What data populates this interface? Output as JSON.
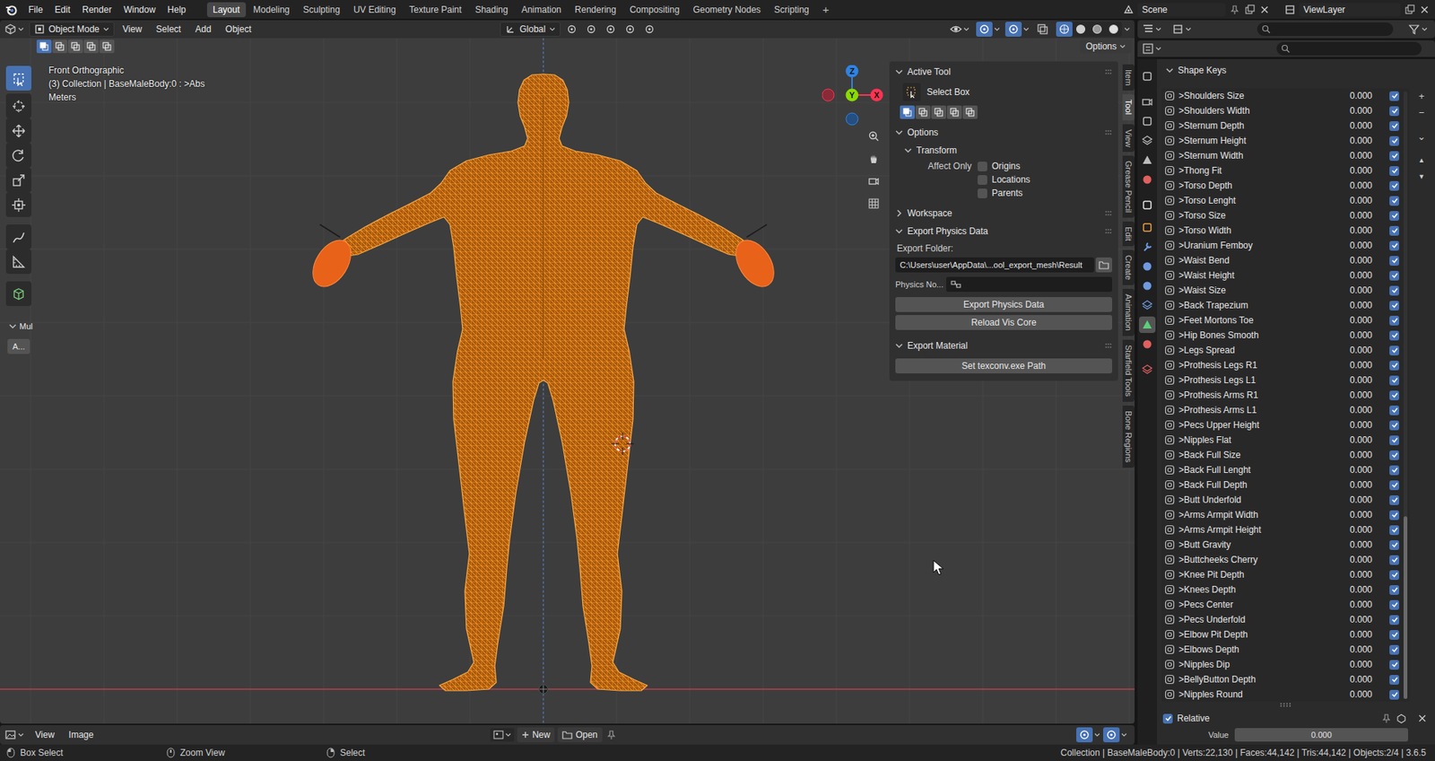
{
  "topbar": {
    "menus": [
      "File",
      "Edit",
      "Render",
      "Window",
      "Help"
    ],
    "workspaces": [
      {
        "label": "Layout",
        "selected": true
      },
      {
        "label": "Modeling",
        "selected": false
      },
      {
        "label": "Sculpting",
        "selected": false
      },
      {
        "label": "UV Editing",
        "selected": false
      },
      {
        "label": "Texture Paint",
        "selected": false
      },
      {
        "label": "Shading",
        "selected": false
      },
      {
        "label": "Animation",
        "selected": false
      },
      {
        "label": "Rendering",
        "selected": false
      },
      {
        "label": "Compositing",
        "selected": false
      },
      {
        "label": "Geometry Nodes",
        "selected": false
      },
      {
        "label": "Scripting",
        "selected": false
      }
    ],
    "add_workspace": "+",
    "scene": "Scene",
    "view_layer": "ViewLayer"
  },
  "viewport": {
    "mode": "Object Mode",
    "menus": [
      "View",
      "Select",
      "Add",
      "Object"
    ],
    "orientation": "Global",
    "options": "Options",
    "select_modes": [
      {
        "selected": true
      },
      {
        "selected": false
      },
      {
        "selected": false
      },
      {
        "selected": false
      },
      {
        "selected": false
      }
    ],
    "shading": [
      {
        "selected": true
      },
      {
        "selected": false
      },
      {
        "selected": false
      },
      {
        "selected": false
      }
    ],
    "info": [
      "Front Orthographic",
      "(3) Collection | BaseMaleBody:0 : >Abs",
      "Meters"
    ],
    "gizmo": {
      "z": "Z",
      "y": "Y",
      "x": "X"
    },
    "tools": [
      {
        "selected": true
      },
      {
        "selected": false
      },
      {
        "selected": false
      },
      {
        "selected": false
      },
      {
        "selected": false
      },
      {
        "selected": false
      },
      {
        "selected": false
      },
      {
        "selected": false
      },
      {
        "selected": false
      }
    ],
    "tool_panel": {
      "title": "Mul",
      "expanded": true,
      "button": "A..."
    }
  },
  "sidebar": {
    "tabs": [
      {
        "label": "Item",
        "selected": false
      },
      {
        "label": "Tool",
        "selected": true
      },
      {
        "label": "View",
        "selected": false
      },
      {
        "label": "Grease Pencil",
        "selected": false
      },
      {
        "label": "Edit",
        "selected": false
      },
      {
        "label": "Create",
        "selected": false
      },
      {
        "label": "Animation",
        "selected": false
      },
      {
        "label": "Starfield Tools",
        "selected": false
      },
      {
        "label": "Bone Regions",
        "selected": false
      }
    ],
    "active_tool": {
      "title": "Active Tool",
      "expanded": true,
      "tool": "Select Box",
      "modes": [
        {
          "selected": true
        },
        {
          "selected": false
        },
        {
          "selected": false
        },
        {
          "selected": false
        },
        {
          "selected": false
        }
      ]
    },
    "options": {
      "title": "Options",
      "expanded": true,
      "transform": {
        "title": "Transform",
        "expanded": true,
        "label": "Affect Only",
        "checks": [
          {
            "label": "Origins",
            "checked": false
          },
          {
            "label": "Locations",
            "checked": false
          },
          {
            "label": "Parents",
            "checked": false
          }
        ]
      }
    },
    "workspace": {
      "title": "Workspace",
      "expanded": false
    },
    "export_physics": {
      "title": "Export Physics Data",
      "expanded": true,
      "folder_label": "Export Folder:",
      "folder": "C:\\Users\\user\\AppData\\...ool_export_mesh\\Result",
      "physics_label": "Physics No...",
      "buttons": [
        "Export Physics Data",
        "Reload Vis Core"
      ]
    },
    "export_material": {
      "title": "Export Material",
      "expanded": true,
      "button": "Set texconv.exe Path"
    }
  },
  "properties": {
    "tabs": [
      {
        "selected": false
      },
      {
        "selected": false
      },
      {
        "selected": false
      },
      {
        "selected": false
      },
      {
        "selected": false
      },
      {
        "selected": false
      },
      {
        "selected": false
      },
      {
        "selected": false
      },
      {
        "selected": false
      },
      {
        "selected": false
      },
      {
        "selected": false
      },
      {
        "selected": false
      },
      {
        "selected": true
      },
      {
        "selected": false
      },
      {
        "selected": false
      }
    ],
    "shape_keys": {
      "title": "Shape Keys",
      "expanded": true,
      "keys": [
        {
          "name": ">Shoulders Size",
          "value": "0.000",
          "checked": true
        },
        {
          "name": ">Shoulders Width",
          "value": "0.000",
          "checked": true
        },
        {
          "name": ">Sternum Depth",
          "value": "0.000",
          "checked": true
        },
        {
          "name": ">Sternum Height",
          "value": "0.000",
          "checked": true
        },
        {
          "name": ">Sternum Width",
          "value": "0.000",
          "checked": true
        },
        {
          "name": ">Thong Fit",
          "value": "0.000",
          "checked": true
        },
        {
          "name": ">Torso Depth",
          "value": "0.000",
          "checked": true
        },
        {
          "name": ">Torso Lenght",
          "value": "0.000",
          "checked": true
        },
        {
          "name": ">Torso Size",
          "value": "0.000",
          "checked": true
        },
        {
          "name": ">Torso Width",
          "value": "0.000",
          "checked": true
        },
        {
          "name": ">Uranium Femboy",
          "value": "0.000",
          "checked": true
        },
        {
          "name": ">Waist Bend",
          "value": "0.000",
          "checked": true
        },
        {
          "name": ">Waist Height",
          "value": "0.000",
          "checked": true
        },
        {
          "name": ">Waist Size",
          "value": "0.000",
          "checked": true
        },
        {
          "name": ">Back Trapezium",
          "value": "0.000",
          "checked": true
        },
        {
          "name": ">Feet Mortons Toe",
          "value": "0.000",
          "checked": true
        },
        {
          "name": ">Hip Bones Smooth",
          "value": "0.000",
          "checked": true
        },
        {
          "name": ">Legs Spread",
          "value": "0.000",
          "checked": true
        },
        {
          "name": ">Prothesis Legs R1",
          "value": "0.000",
          "checked": true
        },
        {
          "name": ">Prothesis Legs L1",
          "value": "0.000",
          "checked": true
        },
        {
          "name": ">Prothesis Arms R1",
          "value": "0.000",
          "checked": true
        },
        {
          "name": ">Prothesis Arms L1",
          "value": "0.000",
          "checked": true
        },
        {
          "name": ">Pecs Upper Height",
          "value": "0.000",
          "checked": true
        },
        {
          "name": ">Nipples Flat",
          "value": "0.000",
          "checked": true
        },
        {
          "name": ">Back Full Size",
          "value": "0.000",
          "checked": true
        },
        {
          "name": ">Back Full Lenght",
          "value": "0.000",
          "checked": true
        },
        {
          "name": ">Back Full Depth",
          "value": "0.000",
          "checked": true
        },
        {
          "name": ">Butt Underfold",
          "value": "0.000",
          "checked": true
        },
        {
          "name": ">Arms Armpit Width",
          "value": "0.000",
          "checked": true
        },
        {
          "name": ">Arms Armpit Height",
          "value": "0.000",
          "checked": true
        },
        {
          "name": ">Butt Gravity",
          "value": "0.000",
          "checked": true
        },
        {
          "name": ">Buttcheeks Cherry",
          "value": "0.000",
          "checked": true
        },
        {
          "name": ">Knee Pit Depth",
          "value": "0.000",
          "checked": true
        },
        {
          "name": ">Knees Depth",
          "value": "0.000",
          "checked": true
        },
        {
          "name": ">Pecs Center",
          "value": "0.000",
          "checked": true
        },
        {
          "name": ">Pecs Underfold",
          "value": "0.000",
          "checked": true
        },
        {
          "name": ">Elbow Pit Depth",
          "value": "0.000",
          "checked": true
        },
        {
          "name": ">Elbows Depth",
          "value": "0.000",
          "checked": true
        },
        {
          "name": ">Nipples Dip",
          "value": "0.000",
          "checked": true
        },
        {
          "name": ">BellyButton Depth",
          "value": "0.000",
          "checked": true
        },
        {
          "name": ">Nipples Round",
          "value": "0.000",
          "checked": true
        }
      ],
      "buttons": [
        "+",
        "−",
        "⌄",
        "▲",
        "▼"
      ],
      "relative": {
        "label": "Relative",
        "checked": true
      },
      "value_label": "Value",
      "value": "0.000"
    }
  },
  "image_editor": {
    "menus": [
      "View",
      "Image"
    ],
    "new": "New",
    "open": "Open"
  },
  "status_bar": {
    "hints": [
      "Box Select",
      "Zoom View",
      "Select"
    ],
    "stats": "Collection | BaseMaleBody:0 | Verts:22,130 | Faces:44,142 | Tris:44,142 | Objects:2/4 | 3.6.5"
  }
}
